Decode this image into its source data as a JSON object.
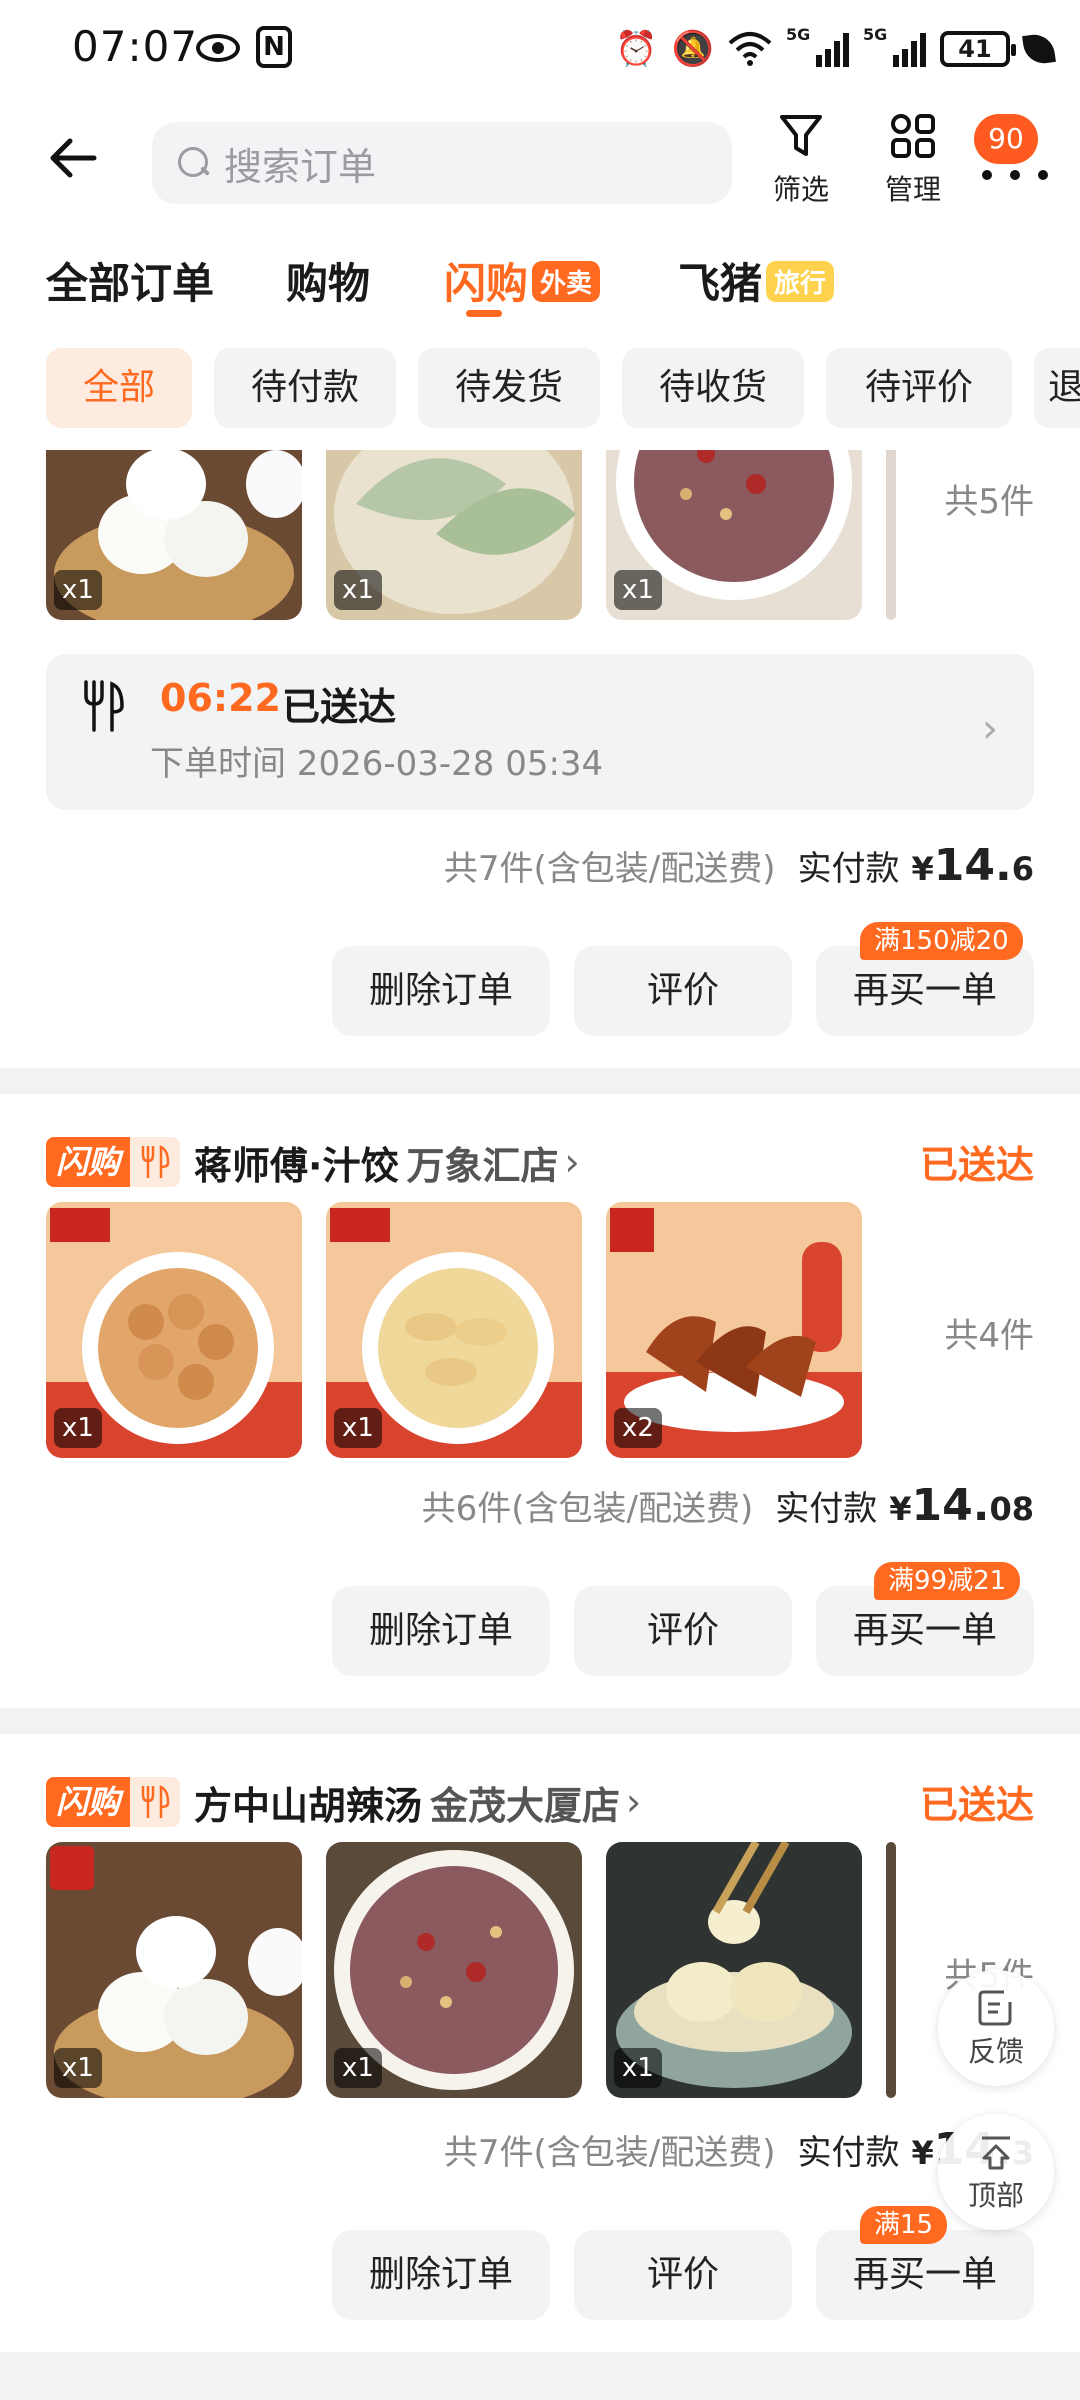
{
  "status_bar": {
    "time": "07:07",
    "battery": "41",
    "signal_label": "5G"
  },
  "header": {
    "search_placeholder": "搜索订单",
    "filter_label": "筛选",
    "manage_label": "管理",
    "more_badge": "90"
  },
  "tabs": [
    {
      "label": "全部订单"
    },
    {
      "label": "购物"
    },
    {
      "label": "闪购",
      "tag": "外卖"
    },
    {
      "label": "飞猪",
      "tag": "旅行"
    }
  ],
  "chips": [
    "全部",
    "待付款",
    "待发货",
    "待收货",
    "待评价",
    "退"
  ],
  "common": {
    "sg_badge": "闪购",
    "delivered": "已送达",
    "paid_label": "实付款",
    "currency": "¥",
    "delete_btn": "删除订单",
    "review_btn": "评价",
    "rebuy_btn": "再买一单"
  },
  "order1": {
    "items": [
      {
        "qty": "x1"
      },
      {
        "qty": "x1"
      },
      {
        "qty": "x1"
      }
    ],
    "count": "共5件",
    "delivery_time": "06:22",
    "delivery_status": "已送达",
    "order_time": "下单时间 2026-03-28 05:34",
    "meta": "共7件(含包装/配送费)",
    "price_int": "14.",
    "price_dec": "6",
    "promo": "满150减20"
  },
  "order2": {
    "shop_name": "蒋师傅·汁饺",
    "shop_branch": "万象汇店",
    "items": [
      {
        "qty": "x1"
      },
      {
        "qty": "x1"
      },
      {
        "qty": "x2"
      }
    ],
    "count": "共4件",
    "meta": "共6件(含包装/配送费)",
    "price_int": "14.",
    "price_dec": "08",
    "promo": "满99减21"
  },
  "order3": {
    "shop_name": "方中山胡辣汤",
    "shop_branch": "金茂大厦店",
    "items": [
      {
        "qty": "x1"
      },
      {
        "qty": "x1"
      },
      {
        "qty": "x1"
      }
    ],
    "count": "共5件",
    "meta": "共7件(含包装/配送费)",
    "price_int": "14.",
    "price_dec": "3",
    "promo": "满15"
  },
  "floating": {
    "feedback": "反馈",
    "top": "顶部"
  }
}
